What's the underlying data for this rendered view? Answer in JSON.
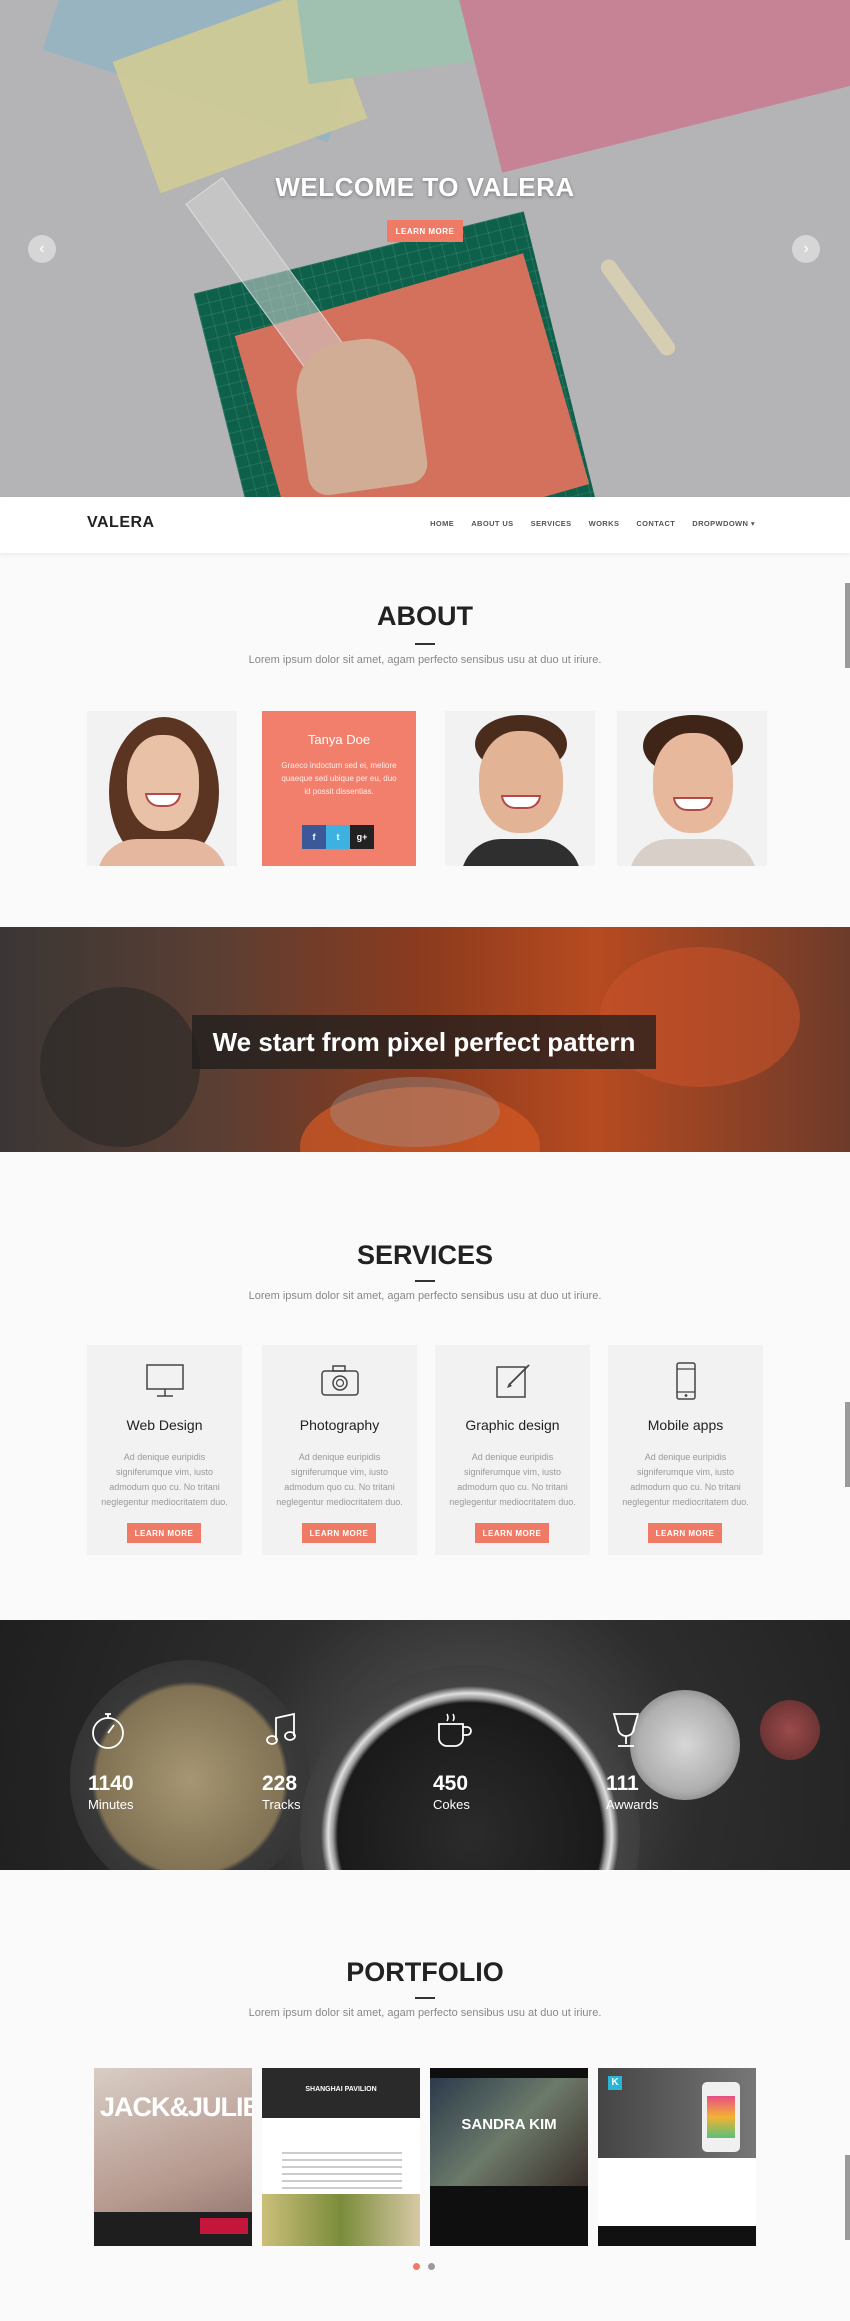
{
  "hero": {
    "title": "WELCOME TO VALERA",
    "button": "LEARN MORE",
    "prev_icon": "chevron-left-icon",
    "next_icon": "chevron-right-icon",
    "prev_glyph": "‹",
    "next_glyph": "›"
  },
  "nav": {
    "brand": "VALERA",
    "items": [
      "HOME",
      "ABOUT US",
      "SERVICES",
      "WORKS",
      "CONTACT",
      "DROPWDOWN ▾"
    ]
  },
  "about": {
    "title": "ABOUT",
    "subtitle": "Lorem ipsum dolor sit amet, agam perfecto sensibus usu at duo ut iriure.",
    "card": {
      "name": "Tanya Doe",
      "desc": "Graeco indoctum sed ei, meliore quaeque sed ubique per eu, duo id possit dissentias.",
      "social": [
        "f",
        "t",
        "g+"
      ]
    }
  },
  "banner": {
    "text": "We start from pixel perfect pattern"
  },
  "services": {
    "title": "SERVICES",
    "subtitle": "Lorem ipsum dolor sit amet, agam perfecto sensibus usu at duo ut iriure.",
    "items": [
      {
        "title": "Web Design",
        "icon": "monitor-icon",
        "desc": "Ad denique euripidis signiferumque vim, iusto admodum quo cu. No tritani neglegentur mediocritatem duo.",
        "button": "LEARN MORE"
      },
      {
        "title": "Photography",
        "icon": "camera-icon",
        "desc": "Ad denique euripidis signiferumque vim, iusto admodum quo cu. No tritani neglegentur mediocritatem duo.",
        "button": "LEARN MORE"
      },
      {
        "title": "Graphic design",
        "icon": "pencil-edit-icon",
        "desc": "Ad denique euripidis signiferumque vim, iusto admodum quo cu. No tritani neglegentur mediocritatem duo.",
        "button": "LEARN MORE"
      },
      {
        "title": "Mobile apps",
        "icon": "smartphone-icon",
        "desc": "Ad denique euripidis signiferumque vim, iusto admodum quo cu. No tritani neglegentur mediocritatem duo.",
        "button": "LEARN MORE"
      }
    ]
  },
  "stats": [
    {
      "number": "1140",
      "label": "Minutes",
      "icon": "stopwatch-icon"
    },
    {
      "number": "228",
      "label": "Tracks",
      "icon": "music-note-icon"
    },
    {
      "number": "450",
      "label": "Cokes",
      "icon": "coffee-cup-icon"
    },
    {
      "number": "111",
      "label": "Awwards",
      "icon": "trophy-icon"
    }
  ],
  "portfolio": {
    "title": "PORTFOLIO",
    "subtitle": "Lorem ipsum dolor sit amet, agam perfecto sensibus usu at duo ut iriure.",
    "items": [
      {
        "title": "JACK&JULIE"
      },
      {
        "title": "SHANGHAI PAVILION"
      },
      {
        "title": "SANDRA KIM"
      },
      {
        "title": "K"
      }
    ],
    "pagination_active": 1
  },
  "colors": {
    "accent": "#ef7b66",
    "dark": "#222222",
    "muted": "#888888"
  }
}
